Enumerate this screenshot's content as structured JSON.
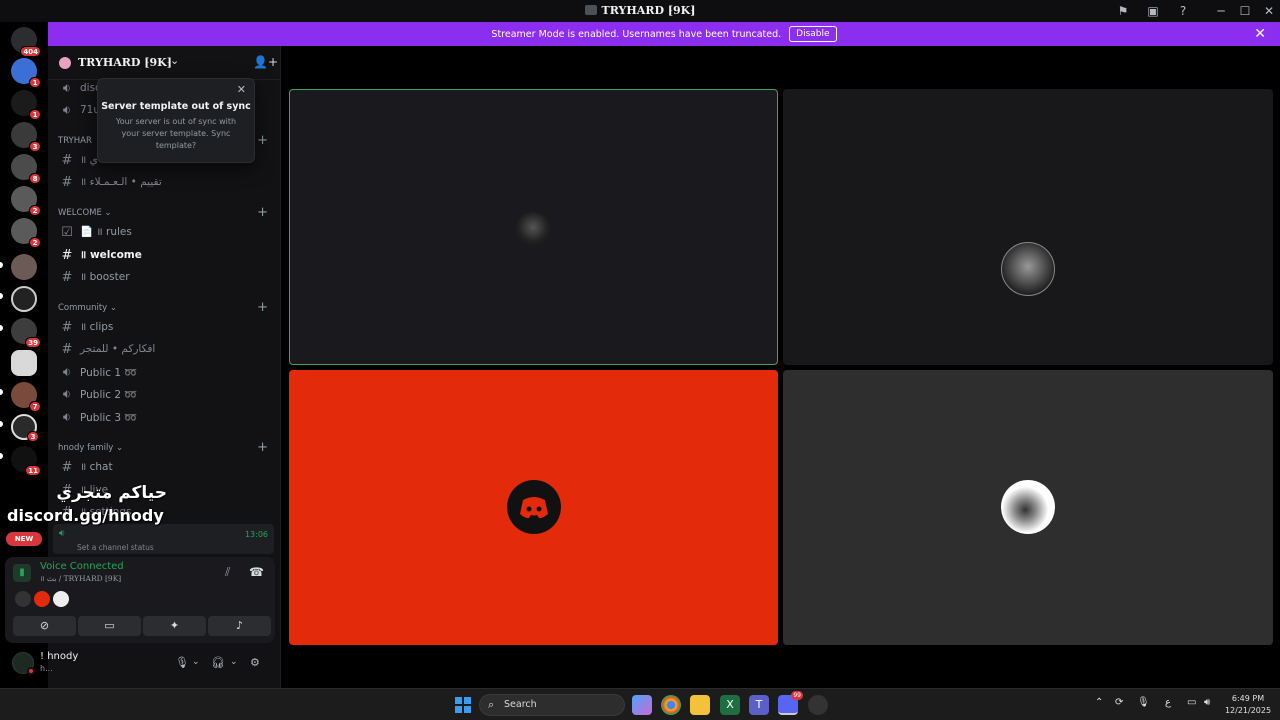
{
  "window": {
    "title": "TRYHARD ⁅9K⁆"
  },
  "streamer_banner": {
    "message": "Streamer Mode is enabled. Usernames have been truncated.",
    "disable_label": "Disable"
  },
  "server_rail": {
    "badges": [
      "404",
      "1",
      "1",
      "3",
      "8",
      "2",
      "2",
      "39",
      "7",
      "3",
      "11"
    ]
  },
  "sidebar": {
    "server_name": "TRYHARD ⁅9K⁆",
    "popup": {
      "title": "Server template out of sync",
      "description": "Your server is out of sync with your server template. Sync template?"
    },
    "channels_top": [
      {
        "label": "disc",
        "icon": "speaker-icon"
      },
      {
        "label": "71u",
        "icon": "speaker-icon"
      }
    ],
    "category_tryhard": "TRYHAR",
    "tryhard_channels": [
      {
        "label": "॥ ي"
      },
      {
        "label": "॥ تقييم • الـعـمـلاء"
      }
    ],
    "category_welcome": "WELCOME",
    "welcome_channels": [
      {
        "label": "📄 ॥ rules"
      },
      {
        "label": "॥ welcome"
      },
      {
        "label": "॥ booster"
      }
    ],
    "category_community": "Community",
    "community_channels": [
      {
        "label": "॥ clips"
      },
      {
        "label": "افكاركم • للمتجر"
      },
      {
        "label": "Public 1 ➿"
      },
      {
        "label": "Public 2 ➿"
      },
      {
        "label": "Public 3 ➿"
      }
    ],
    "category_hnody": "hnody family",
    "hnody_channels": [
      {
        "label": "॥ chat"
      },
      {
        "label": "॥ live"
      },
      {
        "label": "॥ settings"
      }
    ],
    "voice_channel": {
      "timer": "13:06",
      "status": "Set a channel status"
    }
  },
  "overlay": {
    "line1": "حياكم متجري",
    "line2": "discord.gg/hnody",
    "new_badge": "NEW"
  },
  "voice_panel": {
    "status": "Voice Connected",
    "subtitle": "॥ بث / TRYHARD ⁅9K⁆"
  },
  "user_panel": {
    "name": "! hnody",
    "status": "h..."
  },
  "taskbar": {
    "search_placeholder": "Search",
    "discord_badge": "99",
    "lang": "ع",
    "time": "6:49 PM",
    "date": "12/21/2025"
  },
  "colors": {
    "banner": "#8c2ef0",
    "speaking_outline": "#43a25a",
    "tile_red": "#e32a0b",
    "tile_dark": "#1a1a1e",
    "tile_gray": "#2e2e2e",
    "voice_green": "#23a55a"
  }
}
